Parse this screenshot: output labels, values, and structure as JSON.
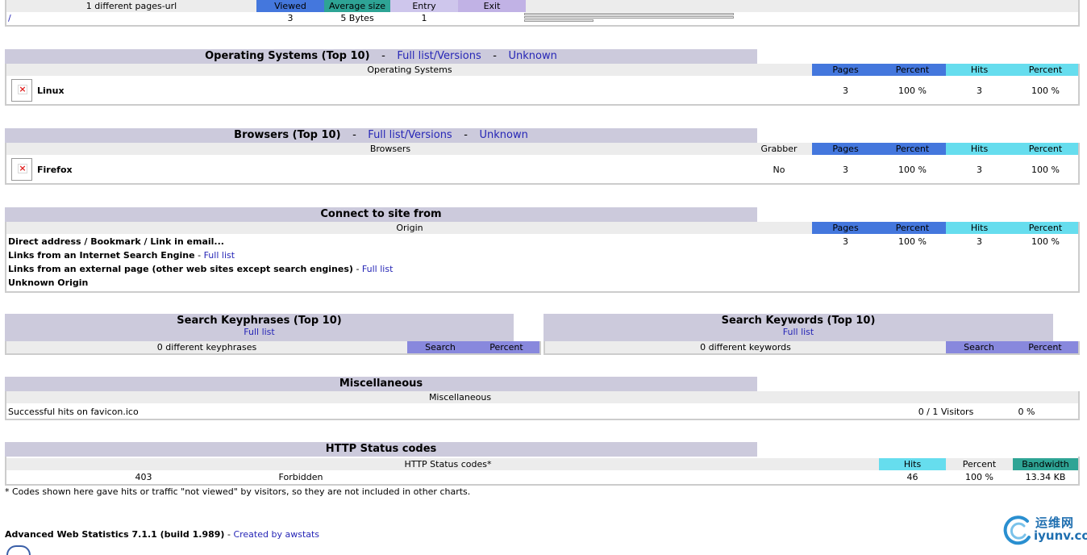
{
  "pages_url": {
    "header": {
      "label": "1 different pages-url",
      "viewed": "Viewed",
      "avg_size": "Average size",
      "entry": "Entry",
      "exit": "Exit"
    },
    "row": {
      "url": "/",
      "viewed": "3",
      "avg_size": "5 Bytes",
      "entry": "1"
    }
  },
  "os": {
    "title": "Operating Systems (Top 10)",
    "full_list": "Full list/Versions",
    "unknown": "Unknown",
    "sep": "-",
    "col_label": "Operating Systems",
    "cols": {
      "pages": "Pages",
      "percent": "Percent",
      "hits": "Hits",
      "hits_percent": "Percent"
    },
    "row": {
      "name": "Linux",
      "icon": "broken-image-icon",
      "pages": "3",
      "percent": "100 %",
      "hits": "3",
      "hits_percent": "100 %"
    }
  },
  "browsers": {
    "title": "Browsers (Top 10)",
    "full_list": "Full list/Versions",
    "unknown": "Unknown",
    "sep": "-",
    "col_label": "Browsers",
    "grabber_label": "Grabber",
    "cols": {
      "pages": "Pages",
      "percent": "Percent",
      "hits": "Hits",
      "hits_percent": "Percent"
    },
    "row": {
      "name": "Firefox",
      "icon": "broken-image-icon",
      "grabber": "No",
      "pages": "3",
      "percent": "100 %",
      "hits": "3",
      "hits_percent": "100 %"
    }
  },
  "connect": {
    "title": "Connect to site from",
    "col_label": "Origin",
    "cols": {
      "pages": "Pages",
      "percent": "Percent",
      "hits": "Hits",
      "hits_percent": "Percent"
    },
    "rows": [
      {
        "label": "Direct address / Bookmark / Link in email...",
        "pages": "3",
        "percent": "100 %",
        "hits": "3",
        "hits_percent": "100 %"
      },
      {
        "label": "Links from an Internet Search Engine",
        "link": "Full list"
      },
      {
        "label": "Links from an external page (other web sites except search engines)",
        "link": "Full list"
      },
      {
        "label": "Unknown Origin"
      }
    ],
    "dash": "-"
  },
  "keyphrases": {
    "title": "Search Keyphrases (Top 10)",
    "full_list": "Full list",
    "count": "0 different keyphrases",
    "search": "Search",
    "percent": "Percent"
  },
  "keywords": {
    "title": "Search Keywords (Top 10)",
    "full_list": "Full list",
    "count": "0 different keywords",
    "search": "Search",
    "percent": "Percent"
  },
  "misc": {
    "title": "Miscellaneous",
    "col_label": "Miscellaneous",
    "row": {
      "label": "Successful hits on favicon.ico",
      "visitors": "0 / 1 Visitors",
      "percent": "0 %"
    }
  },
  "http": {
    "title": "HTTP Status codes",
    "col_label": "HTTP Status codes*",
    "cols": {
      "hits": "Hits",
      "percent": "Percent",
      "bandwidth": "Bandwidth"
    },
    "row": {
      "code": "403",
      "desc": "Forbidden",
      "hits": "46",
      "percent": "100 %",
      "bandwidth": "13.34 KB"
    },
    "note": "* Codes shown here gave hits or traffic \"not viewed\" by visitors, so they are not included in other charts."
  },
  "footer": {
    "text": "Advanced Web Statistics 7.1.1 (build 1.989)",
    "dash": "-",
    "link": "Created by awstats"
  },
  "watermark": {
    "cn": "运维网",
    "site": "iyunv.com"
  }
}
